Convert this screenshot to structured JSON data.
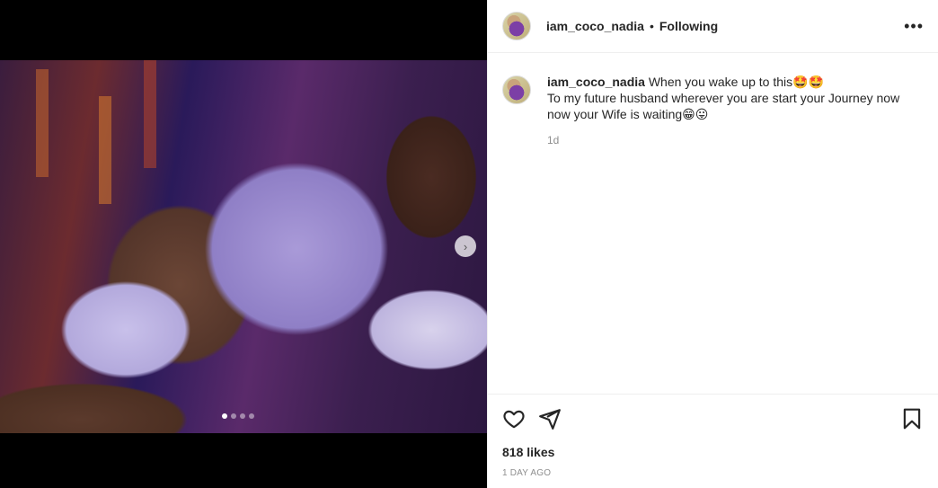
{
  "post": {
    "carousel": {
      "slide_count": 4,
      "current_slide": 1,
      "next_label": "›"
    },
    "header": {
      "username": "iam_coco_nadia",
      "separator": "•",
      "follow_state": "Following",
      "more_label": "•••"
    },
    "caption": {
      "username": "iam_coco_nadia",
      "line1": "When you wake up to this🤩🤩",
      "line2": "To my future husband wherever you are start your Journey now",
      "line3": "now your Wife is waiting😁😛",
      "time": "1d"
    },
    "actions": {
      "icons": [
        "heart-icon",
        "share-icon",
        "bookmark-icon"
      ],
      "likes": "818 likes",
      "posted": "1 DAY AGO"
    }
  }
}
